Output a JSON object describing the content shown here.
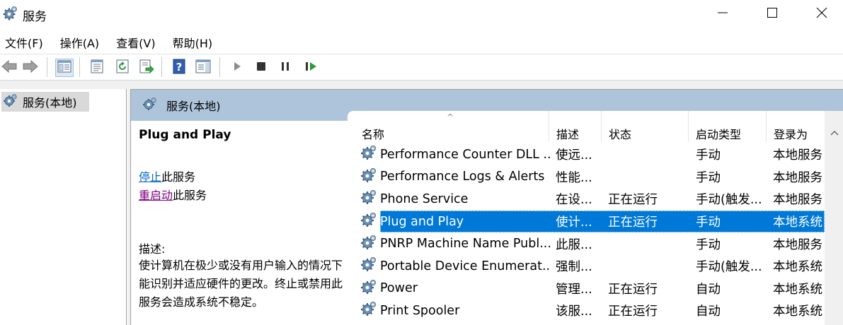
{
  "window": {
    "title": "服务",
    "icon": "gear-icon",
    "controls": [
      "minimize-icon",
      "maximize-icon",
      "close-icon"
    ]
  },
  "menu": [
    {
      "label": "文件(F)"
    },
    {
      "label": "操作(A)"
    },
    {
      "label": "查看(V)"
    },
    {
      "label": "帮助(H)"
    }
  ],
  "toolbar": {
    "buttons": [
      "back-icon",
      "forward-icon",
      "show-hide-tree-icon",
      "properties-icon",
      "refresh-icon",
      "export-list-icon",
      "help-icon",
      "show-action-pane-icon",
      "start-service-icon",
      "stop-service-icon",
      "pause-service-icon",
      "restart-service-icon"
    ]
  },
  "tree": {
    "root_label": "服务(本地)"
  },
  "pane": {
    "header_label": "服务(本地)",
    "selected_service": "Plug and Play",
    "action_stop_link": "停止",
    "action_stop_suffix": "此服务",
    "action_restart_link": "重启动",
    "action_restart_suffix": "此服务",
    "description_label": "描述:",
    "description_text": "使计算机在极少或没有用户输入的情况下能识别并适应硬件的更改。终止或禁用此服务会造成系统不稳定。"
  },
  "list": {
    "columns": [
      "名称",
      "描述",
      "状态",
      "启动类型",
      "登录为"
    ],
    "rows": [
      {
        "name": "Performance Counter DLL ...",
        "desc": "使远...",
        "state": "",
        "startup": "手动",
        "logon": "本地服务"
      },
      {
        "name": "Performance Logs & Alerts",
        "desc": "性能...",
        "state": "",
        "startup": "手动",
        "logon": "本地服务"
      },
      {
        "name": "Phone Service",
        "desc": "在设...",
        "state": "正在运行",
        "startup": "手动(触发...",
        "logon": "本地服务"
      },
      {
        "name": "Plug and Play",
        "desc": "使计...",
        "state": "正在运行",
        "startup": "手动",
        "logon": "本地系统",
        "selected": true
      },
      {
        "name": "PNRP Machine Name Publ...",
        "desc": "此服...",
        "state": "",
        "startup": "手动",
        "logon": "本地服务"
      },
      {
        "name": "Portable Device Enumerat...",
        "desc": "强制...",
        "state": "",
        "startup": "手动(触发...",
        "logon": "本地系统"
      },
      {
        "name": "Power",
        "desc": "管理...",
        "state": "正在运行",
        "startup": "自动",
        "logon": "本地系统"
      },
      {
        "name": "Print Spooler",
        "desc": "该服...",
        "state": "正在运行",
        "startup": "自动",
        "logon": "本地系统"
      }
    ]
  },
  "colors": {
    "selection": "#0078d7",
    "pane_header": "#aec4db",
    "link": "#0066cc",
    "visited_link": "#800080"
  }
}
